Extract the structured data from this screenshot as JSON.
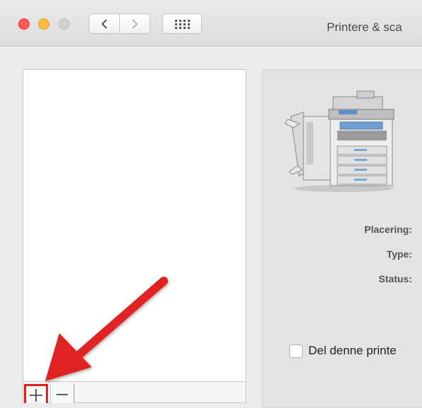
{
  "window": {
    "title": "Printere & sca"
  },
  "details": {
    "labels": {
      "location": "Placering:",
      "type": "Type:",
      "status": "Status:"
    },
    "share_checkbox": {
      "label": "Del denne printe",
      "checked": false
    }
  },
  "list_toolbar": {
    "add_label": "+",
    "remove_label": "−"
  },
  "colors": {
    "close": "#fc5753",
    "minimize": "#fdbc40",
    "zoom": "#d0d0d0",
    "annotation": "#e02020"
  },
  "icons": [
    "chevron-left-icon",
    "chevron-right-icon",
    "grid-icon",
    "printer-icon",
    "arrow-annotation"
  ]
}
